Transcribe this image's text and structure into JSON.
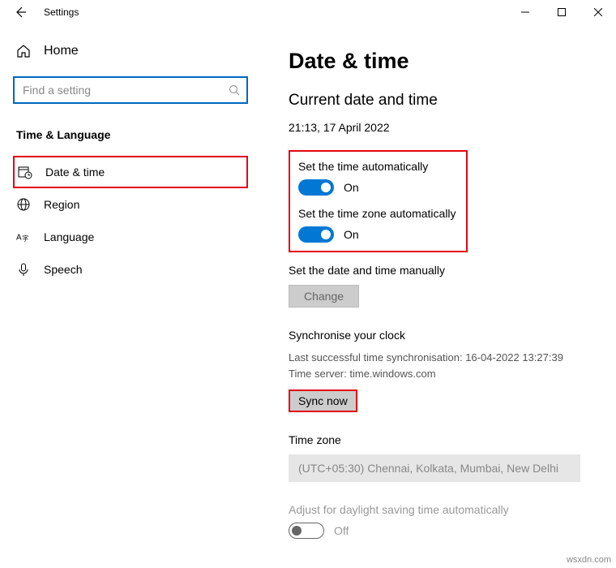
{
  "titlebar": {
    "title": "Settings"
  },
  "sidebar": {
    "home": "Home",
    "search_placeholder": "Find a setting",
    "section": "Time & Language",
    "items": [
      {
        "label": "Date & time"
      },
      {
        "label": "Region"
      },
      {
        "label": "Language"
      },
      {
        "label": "Speech"
      }
    ]
  },
  "main": {
    "title": "Date & time",
    "subtitle": "Current date and time",
    "current": "21:13, 17 April 2022",
    "auto_time_label": "Set the time automatically",
    "auto_time_state": "On",
    "auto_tz_label": "Set the time zone automatically",
    "auto_tz_state": "On",
    "manual_label": "Set the date and time manually",
    "change_btn": "Change",
    "sync_header": "Synchronise your clock",
    "sync_last": "Last successful time synchronisation: 16-04-2022 13:27:39",
    "sync_server": "Time server: time.windows.com",
    "sync_btn": "Sync now",
    "tz_header": "Time zone",
    "tz_value": "(UTC+05:30) Chennai, Kolkata, Mumbai, New Delhi",
    "dst_label": "Adjust for daylight saving time automatically",
    "dst_state": "Off"
  },
  "watermark": "wsxdn.com"
}
